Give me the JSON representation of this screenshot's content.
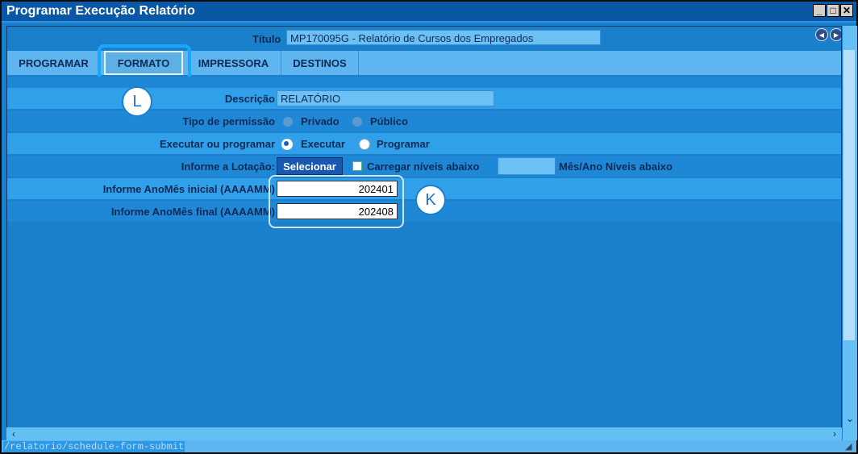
{
  "window": {
    "title": "Programar Execução Relatório",
    "controls": [
      "_",
      "□",
      "✕"
    ]
  },
  "header": {
    "titulo_label": "Título",
    "titulo_value": "MP170095G - Relatório de Cursos dos Empregados"
  },
  "tabs": [
    {
      "label": "PROGRAMAR"
    },
    {
      "label": "FORMATO"
    },
    {
      "label": "IMPRESSORA"
    },
    {
      "label": "DESTINOS"
    }
  ],
  "form": {
    "descricao_label": "Descrição",
    "descricao_value": "RELATÓRIO",
    "permissao_label": "Tipo de permissão",
    "permissao_options": [
      "Privado",
      "Público"
    ],
    "executar_label": "Executar ou programar",
    "executar_options": [
      "Executar",
      "Programar"
    ],
    "lotacao_label": "Informe a Lotação:",
    "selecionar_label": "Selecionar",
    "carregar_label": "Carregar níveis abaixo",
    "mes_ano_label": "Mês/Ano Níveis abaixo",
    "anomes_inicial_label": "Informe AnoMês inicial (AAAAMM)",
    "anomes_inicial_value": "202401",
    "anomes_final_label": "Informe AnoMês final (AAAAMM)",
    "anomes_final_value": "202408"
  },
  "markers": {
    "tab_marker": "L",
    "input_marker": "K"
  },
  "statusbar": {
    "path": "/relatorio/schedule-form-submit"
  },
  "icons": {
    "prev": "arrow-left-icon",
    "next": "arrow-right-icon"
  },
  "colors": {
    "background": "#1b80cc",
    "titlebar": "#0a57a6",
    "band_light": "#30a0ea",
    "band_dark": "#1f88d6",
    "highlight": "#1aa8ff"
  }
}
